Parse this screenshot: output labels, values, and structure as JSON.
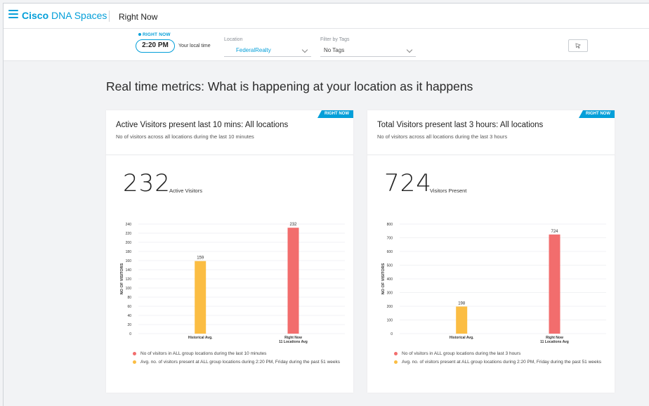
{
  "header": {
    "brand_bold": "Cisco",
    "brand_rest": " DNA Spaces",
    "page": "Right Now"
  },
  "filters": {
    "right_now_label": "RIGHT NOW",
    "time": "2:20 PM",
    "time_label": "Your local time",
    "location_label": "Location",
    "location_value": "FederalRealty",
    "tags_label": "Filter by Tags",
    "tags_value": "No Tags"
  },
  "headline": "Real time metrics: What is happening at your location as it happens",
  "colors": {
    "accent": "#049fd9",
    "historical": "#fbbd43",
    "right_now": "#f26d6d"
  },
  "cards": [
    {
      "badge": "RIGHT NOW",
      "title": "Active Visitors present last 10 mins: All locations",
      "subtitle": "No of visitors across all locations during the last 10 minutes",
      "big_number": "232",
      "big_label": "Active Visitors",
      "legend": [
        "No of visitors in ALL group locations during the last 10 minutes",
        "Avg. no. of visitors present at ALL group locations during 2:20 PM, Friday during the past 51 weeks"
      ]
    },
    {
      "badge": "RIGHT NOW",
      "title": "Total Visitors present last 3 hours: All locations",
      "subtitle": "No of visitors across all locations during the last 3 hours",
      "big_number": "724",
      "big_label": "Visitors Present",
      "legend": [
        "No of visitors in ALL group locations during the last 3 hours",
        "Avg. no. of visitors present at ALL group locations during 2:20 PM, Friday during the past 51 weeks"
      ]
    }
  ],
  "chart_data": [
    {
      "type": "bar",
      "categories": [
        "Historical Avg.",
        "Right Now\n11 Locations Avg"
      ],
      "values": [
        159,
        232
      ],
      "ylabel": "NO OF VISITORS",
      "ylim": [
        0,
        240
      ],
      "yticks": [
        0,
        20,
        40,
        60,
        80,
        100,
        120,
        140,
        160,
        180,
        200,
        220,
        240
      ],
      "grid": true
    },
    {
      "type": "bar",
      "categories": [
        "Historical Avg.",
        "Right Now\n11 Locations Avg"
      ],
      "values": [
        198,
        724
      ],
      "ylabel": "NO OF VISITORS",
      "ylim": [
        0,
        800
      ],
      "yticks": [
        0,
        100,
        200,
        300,
        400,
        500,
        600,
        700,
        800
      ],
      "grid": true
    }
  ]
}
